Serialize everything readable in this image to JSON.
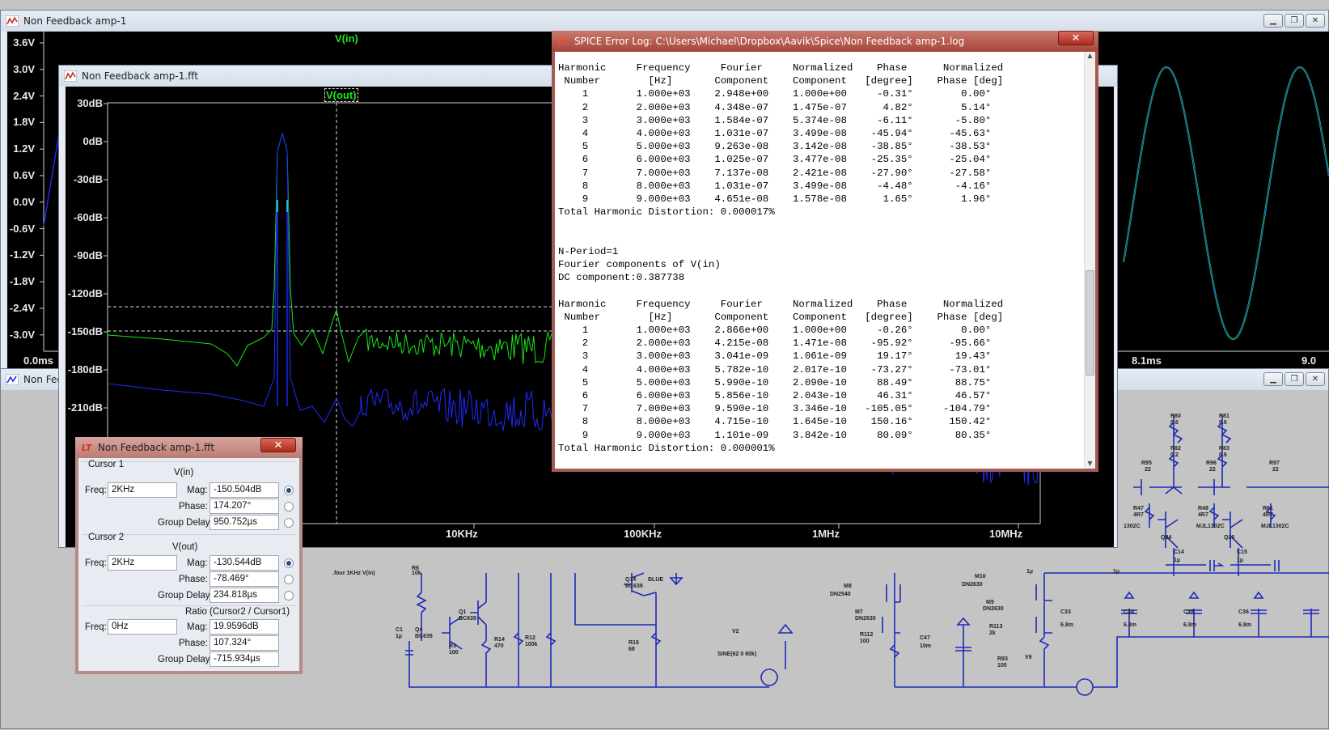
{
  "back_window": {
    "title": "Non Feedback amp-1",
    "trace": "V(in)",
    "y_ticks": [
      "3.6V",
      "3.0V",
      "2.4V",
      "1.8V",
      "1.2V",
      "0.6V",
      "0.0V",
      "-0.6V",
      "-1.2V",
      "-1.8V",
      "-2.4V",
      "-3.0V"
    ],
    "x_ticks": [
      "0.0ms",
      "8.1ms",
      "9.0"
    ]
  },
  "schematic_window": {
    "title": "Non Fee",
    "labels": [
      {
        "t": "R6"
      },
      {
        "t": "10k"
      },
      {
        "t": "C1"
      },
      {
        "t": "1µ"
      },
      {
        "t": "Q4"
      },
      {
        "t": "BC639"
      },
      {
        "t": "Q1"
      },
      {
        "t": "BC639"
      },
      {
        "t": "R3"
      },
      {
        "t": "100"
      },
      {
        "t": "R14"
      },
      {
        "t": "470"
      },
      {
        "t": "R12"
      },
      {
        "t": "100k"
      },
      {
        "t": "Q14"
      },
      {
        "t": "BC639"
      },
      {
        "t": "BLUE"
      },
      {
        "t": "R16"
      },
      {
        "t": "68"
      },
      {
        "t": "V2"
      },
      {
        "t": "SINE(62 0 60k)"
      },
      {
        "t": "M8"
      },
      {
        "t": "DN2540"
      },
      {
        "t": "M7"
      },
      {
        "t": "DN2630"
      },
      {
        "t": "R112"
      },
      {
        "t": "100"
      },
      {
        "t": "C47"
      },
      {
        "t": "10m"
      },
      {
        "t": "M10"
      },
      {
        "t": "DN2630"
      },
      {
        "t": "M9"
      },
      {
        "t": "DN2630"
      },
      {
        "t": "R113"
      },
      {
        "t": "2k"
      },
      {
        "t": "R93"
      },
      {
        "t": "100"
      },
      {
        "t": "V9"
      },
      {
        "t": "1µ"
      },
      {
        "t": "C33"
      },
      {
        "t": "6.8m"
      },
      {
        "t": "C34"
      },
      {
        "t": "6.8m"
      },
      {
        "t": "C35"
      },
      {
        "t": "6.8m"
      },
      {
        "t": "C36"
      },
      {
        "t": "6.8m"
      },
      {
        "t": "R80"
      },
      {
        "t": "0.6"
      },
      {
        "t": "R81"
      },
      {
        "t": "0.6"
      },
      {
        "t": "R82"
      },
      {
        "t": "0.2"
      },
      {
        "t": "R83"
      },
      {
        "t": "0.6"
      },
      {
        "t": "R95"
      },
      {
        "t": "22"
      },
      {
        "t": "R96"
      },
      {
        "t": "22"
      },
      {
        "t": "R97"
      },
      {
        "t": "22"
      },
      {
        "t": "R47"
      },
      {
        "t": "4R7"
      },
      {
        "t": "R48"
      },
      {
        "t": "4R7"
      },
      {
        "t": "R61"
      },
      {
        "t": "4R7"
      },
      {
        "t": "MJL1302C"
      },
      {
        "t": "MJL1302C"
      },
      {
        "t": "Q24"
      },
      {
        "t": "Q26"
      },
      {
        "t": "C14"
      },
      {
        "t": "1µ"
      },
      {
        "t": "C15"
      },
      {
        "t": "1µ"
      },
      {
        "t": "1µ"
      },
      {
        "t": "1302C"
      },
      {
        "t": ".four 1KHz V(in)"
      }
    ]
  },
  "fft_window": {
    "title": "Non Feedback amp-1.fft",
    "trace": "V(out)",
    "y_ticks": [
      "30dB",
      "0dB",
      "-30dB",
      "-60dB",
      "-90dB",
      "-120dB",
      "-150dB",
      "-180dB",
      "-210dB",
      "-3"
    ],
    "x_ticks": [
      "10KHz",
      "100KHz",
      "1MHz",
      "10MHz"
    ]
  },
  "cursor_window": {
    "title": "Non Feedback amp-1.fft",
    "cursor1": {
      "header": "Cursor 1",
      "trace": "V(in)",
      "freq_label": "Freq:",
      "freq": "2KHz",
      "mag_label": "Mag:",
      "mag": "-150.504dB",
      "phase_label": "Phase:",
      "phase": "174.207°",
      "gd_label": "Group Delay:",
      "gd": "950.752µs"
    },
    "cursor2": {
      "header": "Cursor 2",
      "trace": "V(out)",
      "freq_label": "Freq:",
      "freq": "2KHz",
      "mag_label": "Mag:",
      "mag": "-130.544dB",
      "phase_label": "Phase:",
      "phase": "-78.469°",
      "gd_label": "Group Delay:",
      "gd": "234.818µs"
    },
    "ratio": {
      "header": "Ratio (Cursor2 / Cursor1)",
      "freq_label": "Freq:",
      "freq": "0Hz",
      "mag_label": "Mag:",
      "mag": "19.9596dB",
      "phase_label": "Phase:",
      "phase": "107.324°",
      "gd_label": "Group Delay:",
      "gd": "-715.934µs"
    },
    "close": "✕"
  },
  "log_window": {
    "title": "SPICE Error Log: C:\\Users\\Michael\\Dropbox\\Aavik\\Spice\\Non Feedback amp-1.log",
    "close": "✕",
    "lines": [
      "Harmonic     Frequency     Fourier     Normalized    Phase      Normalized",
      " Number        [Hz]       Component    Component   [degree]    Phase [deg]",
      "    1        1.000e+03    2.948e+00    1.000e+00     -0.31°        0.00°",
      "    2        2.000e+03    4.348e-07    1.475e-07      4.82°        5.14°",
      "    3        3.000e+03    1.584e-07    5.374e-08     -6.11°       -5.80°",
      "    4        4.000e+03    1.031e-07    3.499e-08    -45.94°      -45.63°",
      "    5        5.000e+03    9.263e-08    3.142e-08    -38.85°      -38.53°",
      "    6        6.000e+03    1.025e-07    3.477e-08    -25.35°      -25.04°",
      "    7        7.000e+03    7.137e-08    2.421e-08    -27.90°      -27.58°",
      "    8        8.000e+03    1.031e-07    3.499e-08     -4.48°       -4.16°",
      "    9        9.000e+03    4.651e-08    1.578e-08      1.65°        1.96°",
      "Total Harmonic Distortion: 0.000017%",
      "",
      "",
      "N-Period=1",
      "Fourier components of V(in)",
      "DC component:0.387738",
      "",
      "Harmonic     Frequency     Fourier     Normalized    Phase      Normalized",
      " Number        [Hz]       Component    Component   [degree]    Phase [deg]",
      "    1        1.000e+03    2.866e+00    1.000e+00     -0.26°        0.00°",
      "    2        2.000e+03    4.215e-08    1.471e-08    -95.92°      -95.66°",
      "    3        3.000e+03    3.041e-09    1.061e-09     19.17°       19.43°",
      "    4        4.000e+03    5.782e-10    2.017e-10    -73.27°      -73.01°",
      "    5        5.000e+03    5.990e-10    2.090e-10     88.49°       88.75°",
      "    6        6.000e+03    5.856e-10    2.043e-10     46.31°       46.57°",
      "    7        7.000e+03    9.590e-10    3.346e-10   -105.05°     -104.79°",
      "    8        8.000e+03    4.715e-10    1.645e-10    150.16°      150.42°",
      "    9        9.000e+03    1.101e-09    3.842e-10     80.09°       80.35°",
      "Total Harmonic Distortion: 0.000001%"
    ]
  },
  "colors": {
    "green_trace": "#19e619",
    "blue_trace": "#1f2bff",
    "cyan_trace": "#2ad8d8",
    "plot_bg": "#000000",
    "title_accent": "#b02a1c"
  }
}
